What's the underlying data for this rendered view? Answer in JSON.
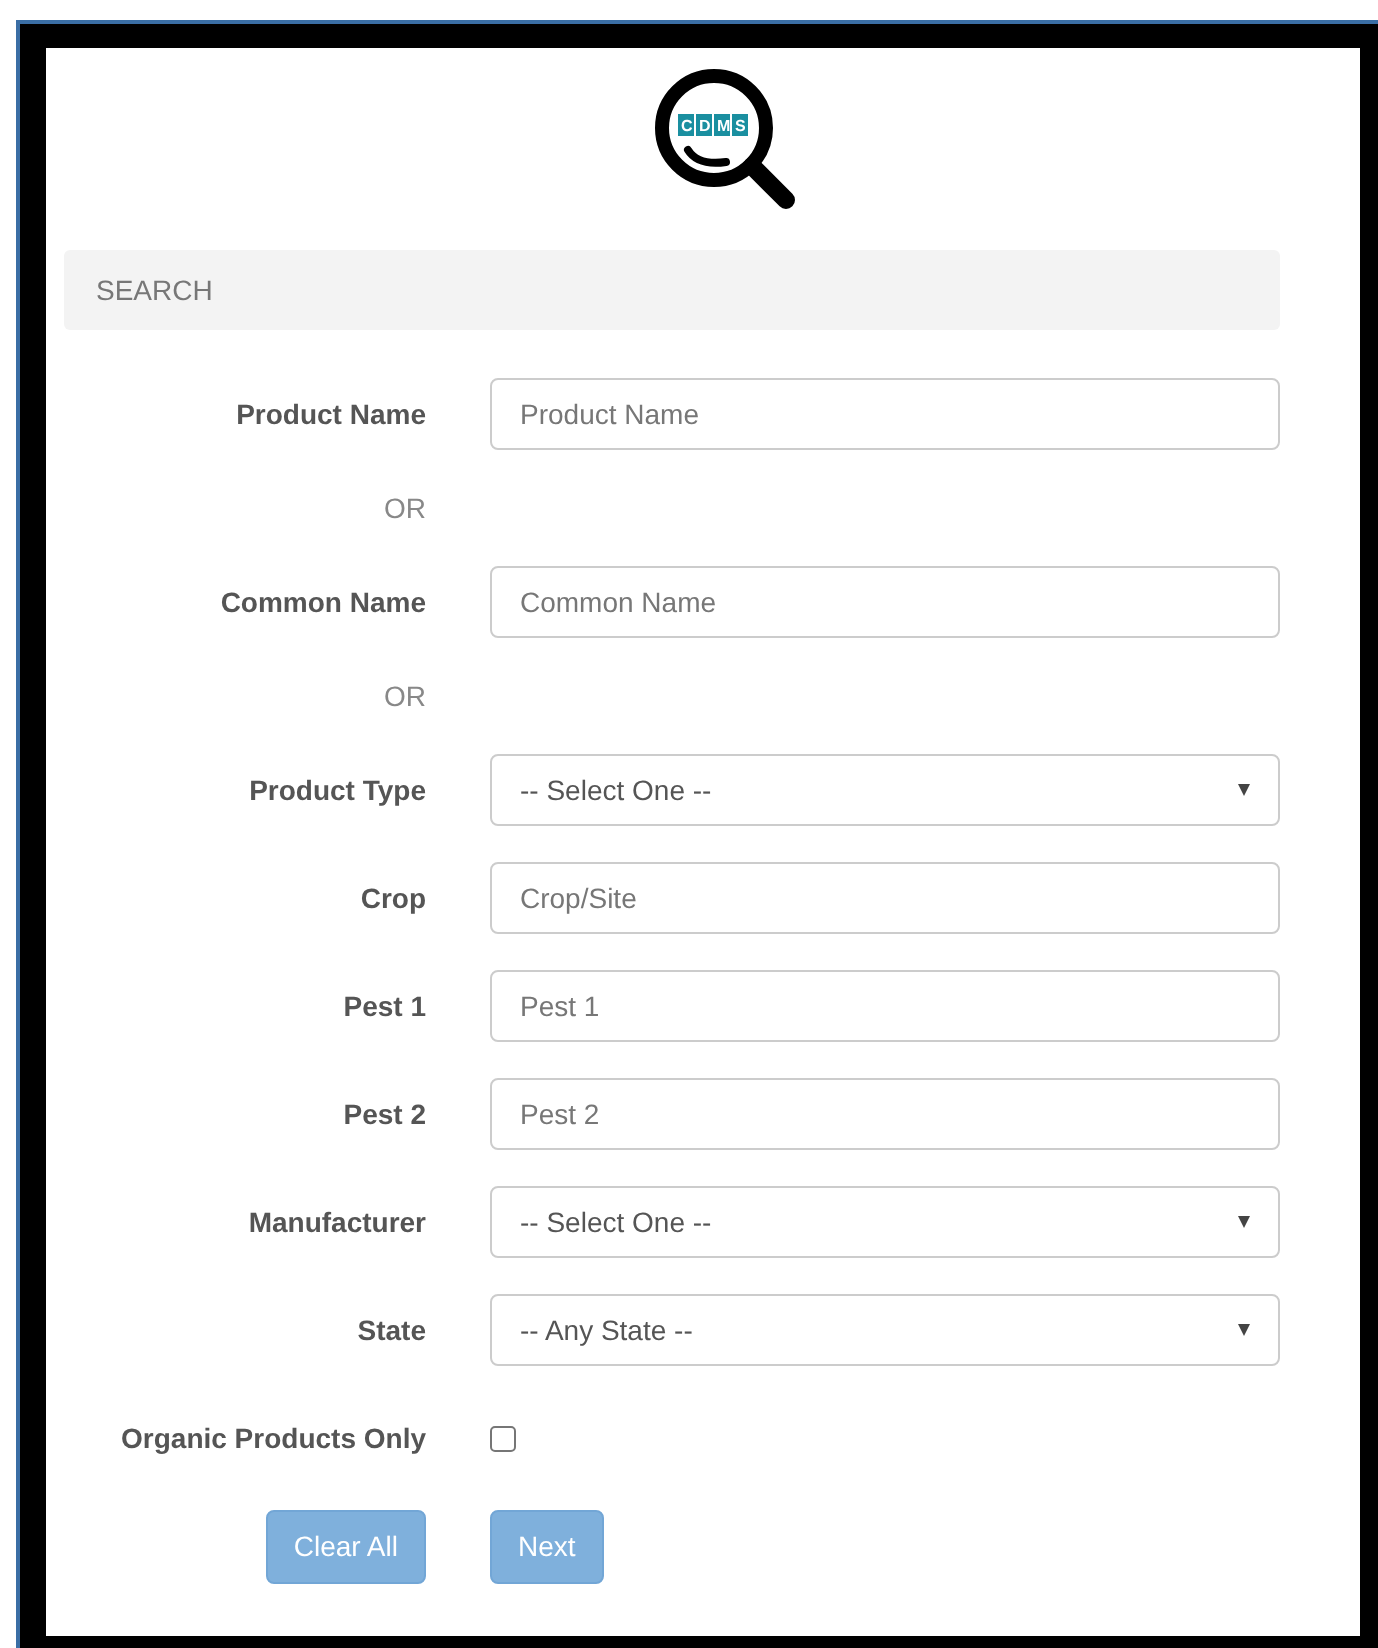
{
  "logo": {
    "text": "CDMS"
  },
  "section_header": "SEARCH",
  "fields": [
    {
      "kind": "input",
      "label": "Product Name",
      "placeholder": "Product Name"
    },
    {
      "kind": "or",
      "label": "OR"
    },
    {
      "kind": "input",
      "label": "Common Name",
      "placeholder": "Common Name"
    },
    {
      "kind": "or",
      "label": "OR"
    },
    {
      "kind": "select",
      "label": "Product Type",
      "value": "-- Select One --"
    },
    {
      "kind": "input",
      "label": "Crop",
      "placeholder": "Crop/Site"
    },
    {
      "kind": "input",
      "label": "Pest 1",
      "placeholder": "Pest 1"
    },
    {
      "kind": "input",
      "label": "Pest 2",
      "placeholder": "Pest 2"
    },
    {
      "kind": "select",
      "label": "Manufacturer",
      "value": "-- Select One --"
    },
    {
      "kind": "select",
      "label": "State",
      "value": "-- Any State --"
    },
    {
      "kind": "checkbox",
      "label": "Organic Products Only",
      "checked": false
    }
  ],
  "buttons": [
    {
      "label": "Clear All",
      "disabled": true
    },
    {
      "label": "Next",
      "disabled": true
    }
  ]
}
